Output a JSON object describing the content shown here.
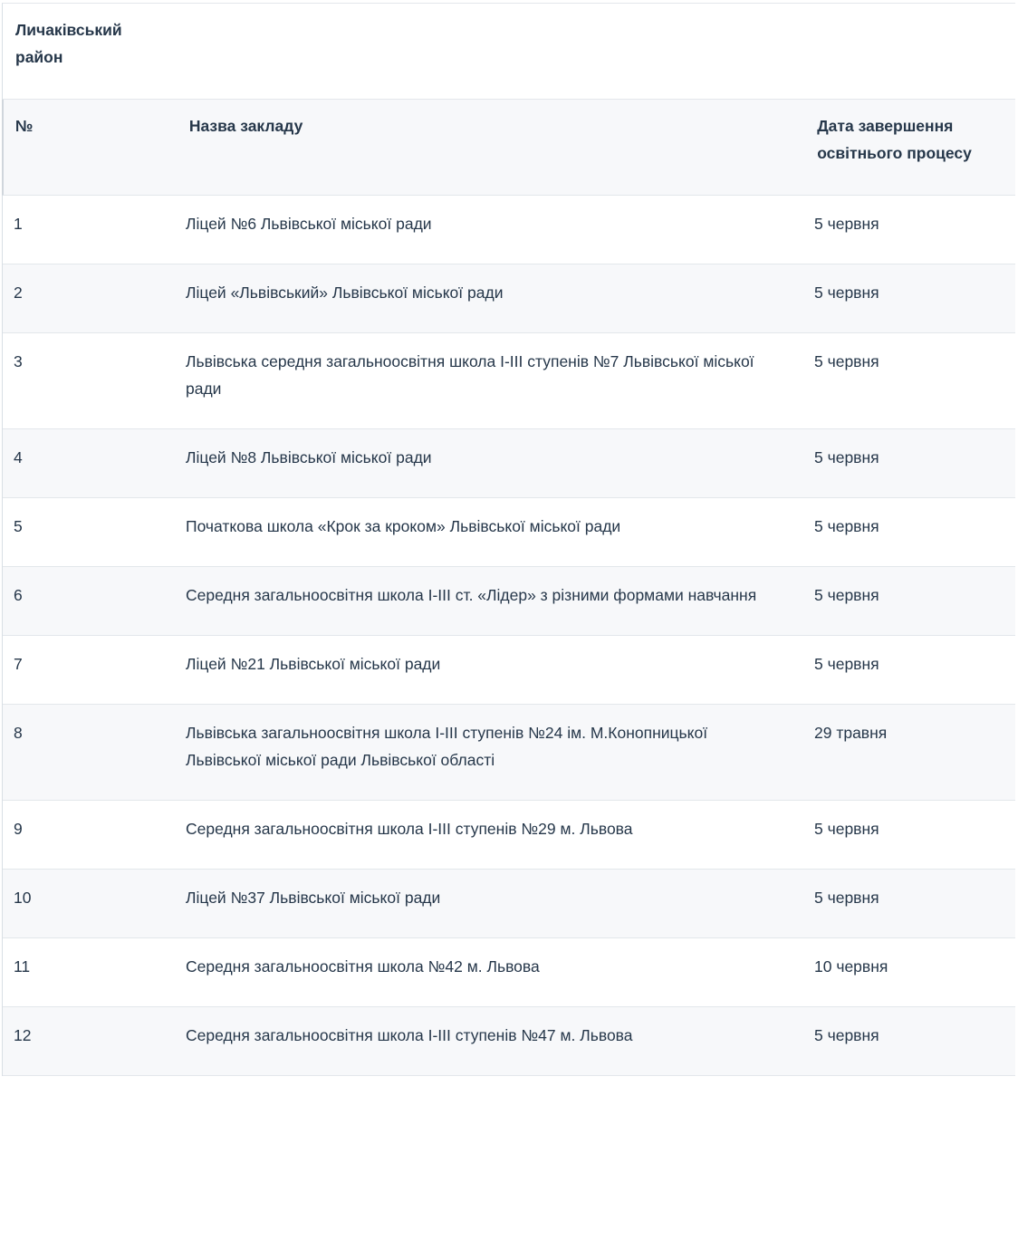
{
  "district": {
    "label": "Личаківський район"
  },
  "table": {
    "headers": {
      "num": "№",
      "name": "Назва закладу",
      "date": "Дата завершення освітнього процесу"
    },
    "rows": [
      {
        "num": "1",
        "name": "Ліцей №6 Львівської міської ради",
        "date": "5 червня"
      },
      {
        "num": "2",
        "name": "Ліцей «Львівський» Львівської міської ради",
        "date": "5 червня"
      },
      {
        "num": "3",
        "name": "Львівська середня загальноосвітня школа І-ІІІ ступенів №7 Львівської міської ради",
        "date": "5 червня"
      },
      {
        "num": "4",
        "name": "Ліцей №8 Львівської міської ради",
        "date": "5 червня"
      },
      {
        "num": "5",
        "name": "Початкова школа «Крок за кроком» Львівської міської ради",
        "date": "5 червня"
      },
      {
        "num": "6",
        "name": "Середня загальноосвітня школа І-ІІІ ст. «Лідер» з різними формами навчання",
        "date": "5 червня"
      },
      {
        "num": "7",
        "name": "Ліцей №21 Львівської міської ради",
        "date": "5 червня"
      },
      {
        "num": "8",
        "name": "Львівська загальноосвітня школа І-ІІІ ступенів №24 ім. М.Конопницької Львівської міської ради Львівської області",
        "date": "29 травня"
      },
      {
        "num": "9",
        "name": "Середня загальноосвітня школа І-ІІІ ступенів №29 м. Львова",
        "date": "5 червня"
      },
      {
        "num": "10",
        "name": "Ліцей №37 Львівської міської ради",
        "date": "5 червня"
      },
      {
        "num": "11",
        "name": "Середня загальноосвітня школа №42 м. Львова",
        "date": "10 червня"
      },
      {
        "num": "12",
        "name": "Середня загальноосвітня школа І-ІІІ ступенів №47 м. Львова",
        "date": "5 червня"
      }
    ]
  }
}
